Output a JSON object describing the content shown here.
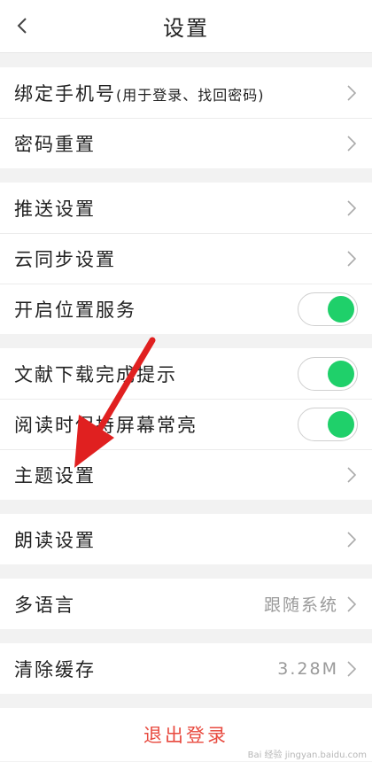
{
  "header": {
    "title": "设置",
    "back_icon": "chevron-left-icon"
  },
  "groups": [
    {
      "rows": [
        {
          "label": "绑定手机号",
          "sub": "(用于登录、找回密码)",
          "control": "chevron"
        },
        {
          "label": "密码重置",
          "control": "chevron"
        }
      ]
    },
    {
      "rows": [
        {
          "label": "推送设置",
          "control": "chevron"
        },
        {
          "label": "云同步设置",
          "control": "chevron"
        },
        {
          "label": "开启位置服务",
          "control": "toggle",
          "on": true
        }
      ]
    },
    {
      "rows": [
        {
          "label": "文献下载完成提示",
          "control": "toggle",
          "on": true
        },
        {
          "label": "阅读时保持屏幕常亮",
          "control": "toggle",
          "on": true
        },
        {
          "label": "主题设置",
          "control": "chevron"
        }
      ]
    },
    {
      "rows": [
        {
          "label": "朗读设置",
          "control": "chevron"
        }
      ]
    },
    {
      "rows": [
        {
          "label": "多语言",
          "value": "跟随系统",
          "control": "chevron"
        }
      ]
    },
    {
      "rows": [
        {
          "label": "清除缓存",
          "value": "3.28M",
          "control": "chevron"
        }
      ]
    }
  ],
  "logout": {
    "label": "退出登录"
  },
  "colors": {
    "toggle_on": "#1fd06a",
    "logout": "#e84a3f",
    "annotation_arrow": "#e02020"
  },
  "watermark": {
    "text": "Bai 经验 jingyan.baidu.com"
  }
}
